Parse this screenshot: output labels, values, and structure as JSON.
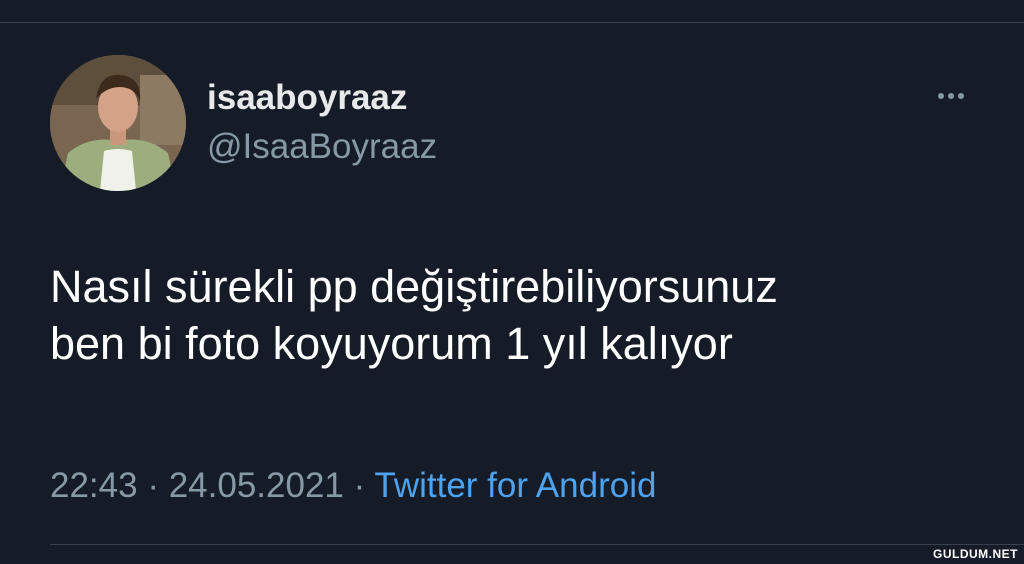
{
  "user": {
    "display_name": "isaaboyraaz",
    "handle": "@IsaaBoyraaz"
  },
  "tweet": {
    "lines": [
      "Nasıl sürekli pp değiştirebiliyorsunuz",
      "ben bi foto koyuyorum 1 yıl kalıyor"
    ],
    "time": "22:43",
    "separator": "·",
    "date": "24.05.2021",
    "source": "Twitter for Android"
  },
  "icons": {
    "more": "more-options-icon",
    "avatar": "profile-photo"
  },
  "watermark": "GULDUM.NET",
  "colors": {
    "background": "#151c27",
    "text_primary": "#ffffff",
    "text_secondary": "#8899a6",
    "link": "#4da3f0",
    "divider": "#38414d"
  }
}
